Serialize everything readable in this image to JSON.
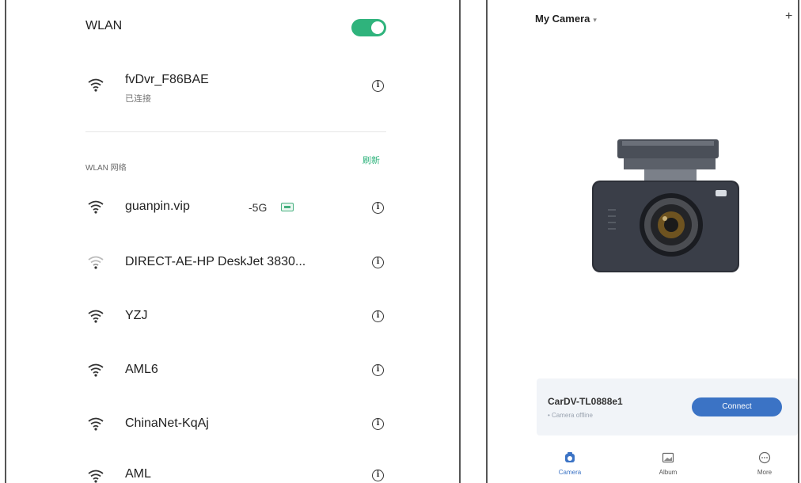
{
  "wlan": {
    "title": "WLAN",
    "toggle_on": true,
    "connected_network": {
      "ssid": "fvDvr_F86BAE",
      "status": "已连接"
    },
    "section_label": "WLAN 网络",
    "refresh_label": "刷新",
    "networks": [
      {
        "ssid": "guanpin.vip",
        "band": "-5G"
      },
      {
        "ssid": "DIRECT-AE-HP DeskJet 3830..."
      },
      {
        "ssid": "YZJ"
      },
      {
        "ssid": "AML6"
      },
      {
        "ssid": "ChinaNet-KqAj"
      },
      {
        "ssid": "AML"
      }
    ],
    "colors": {
      "accent": "#2fb37c"
    }
  },
  "camera_app": {
    "header_title": "My Camera",
    "device": {
      "name": "CarDV-TL0888e1",
      "status": "• Camera offline"
    },
    "connect_label": "Connect",
    "tabs": [
      {
        "label": "Camera",
        "icon": "camera-icon",
        "active": true
      },
      {
        "label": "Album",
        "icon": "album-icon"
      },
      {
        "label": "More",
        "icon": "more-icon"
      }
    ],
    "colors": {
      "accent": "#3b73c5"
    }
  }
}
